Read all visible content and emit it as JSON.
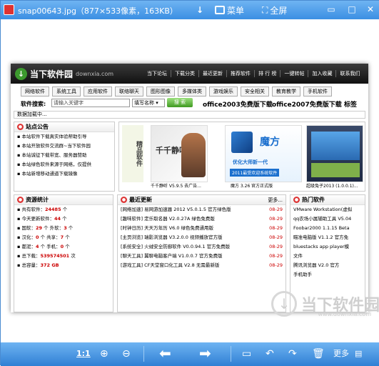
{
  "titlebar": {
    "title": "snap00643.jpg（877×533像素，163KB）",
    "down_label": "↓",
    "menu_label": "菜单",
    "fullscreen_label": "全屏"
  },
  "site": {
    "logo": "当下软件园",
    "domain": "downxia.com",
    "nav": [
      "当下论坛",
      "下载分类",
      "最近更新",
      "推荐软件",
      "排 行 榜",
      "一键转帖",
      "加入收藏",
      "联系我们"
    ],
    "categories": [
      "网络软件",
      "系统工具",
      "应用软件",
      "联络聊天",
      "图形图像",
      "多媒体类",
      "游戏娱乐",
      "安全相关",
      "教育教学",
      "手机软件"
    ],
    "search_label": "软件搜索:",
    "search_placeholder": "请输入关键字",
    "search_select": "填写名称",
    "search_button": "搜 索",
    "hot1": "office2003免费版下载",
    "hot2": "office2007免费版下载",
    "hot3": "标签",
    "loading": "数据加载中..."
  },
  "notice": {
    "title": "站点公告",
    "items": [
      "本站软件下载真实体验帮助引导",
      "本站开放软件交流群~当下软件园",
      "本站诚征下载带宽、服务器赞助",
      "本站绿色软件来源于网络，仅提供",
      "本站新增移动通道下载镜像"
    ]
  },
  "feature": {
    "badge": "精品软件",
    "items": [
      {
        "title": "千千静听",
        "caption": "千千静听 V5.9.5 去广告..."
      },
      {
        "title": "魔方",
        "sub": "优化大师新一代",
        "sub2": "2011最受欢迎系统软件",
        "caption": "魔方 3.26 官方正式版"
      },
      {
        "caption": "超级兔子2013 (1.0.0.1)..."
      }
    ]
  },
  "stats": {
    "title": "资源统计",
    "rows": [
      {
        "label": "共有软件：",
        "value": "24485",
        "unit": "个"
      },
      {
        "label": "今天更新软件：",
        "value": "44",
        "unit": "个"
      },
      {
        "label": "国软：",
        "value": "29",
        "unit": "个 外软：",
        "value2": "3",
        "unit2": "个"
      },
      {
        "label": "汉化：",
        "value": "0",
        "unit": "个 共享：",
        "value2": "7",
        "unit2": "个"
      },
      {
        "label": "都泥：",
        "value": "4",
        "unit": "个 手机：",
        "value2": "0",
        "unit2": "个"
      },
      {
        "label": "总下载：",
        "value": "539574501",
        "unit": "次"
      },
      {
        "label": "总容量：",
        "value": "372 GB",
        "unit": ""
      }
    ]
  },
  "latest": {
    "title": "最近更新",
    "more": "更多...",
    "items": [
      {
        "text": "[网络加速] 易网游加速器 2012 V5.0.1.5 官方绿色版",
        "date": "08-29"
      },
      {
        "text": "[趣味软件] 定乐取名器 V2.0.27A 绿色免费版",
        "date": "08-29"
      },
      {
        "text": "[时钟日历] 天天万年历 V6.0 绿色免费通用版",
        "date": "08-29"
      },
      {
        "text": "[主页浏览] 瑞影浏览器 V3.2.0.0 视频播放官方版",
        "date": "08-29"
      },
      {
        "text": "[系统安全] 火绒安全防御软件 V0.0.94.1 官方免费版",
        "date": "08-29"
      },
      {
        "text": "[聊天工具] 翼聊电脑客户端 V1.0.0.7 官方免费版",
        "date": "08-29"
      },
      {
        "text": "[游戏工具] CF天堂窗口化工具 V2.8 无需最新版",
        "date": "08-29"
      }
    ]
  },
  "hot": {
    "title": "热门软件",
    "items": [
      "VMware Workstation(虚拟",
      "qq农场小属辅助工具 V5.04",
      "Foobar2000 1.1.15 Beta",
      "瞄准电脑版 V1.1.2 官方免",
      "bluestacks app player模",
      "文件",
      "腾讯浏览器 V2.0 官方",
      "手机助手"
    ]
  },
  "watermark": {
    "text": "当下软件园",
    "sub": "www.downxia.com"
  },
  "toolbar": {
    "ratio": "1:1",
    "more": "更多"
  }
}
